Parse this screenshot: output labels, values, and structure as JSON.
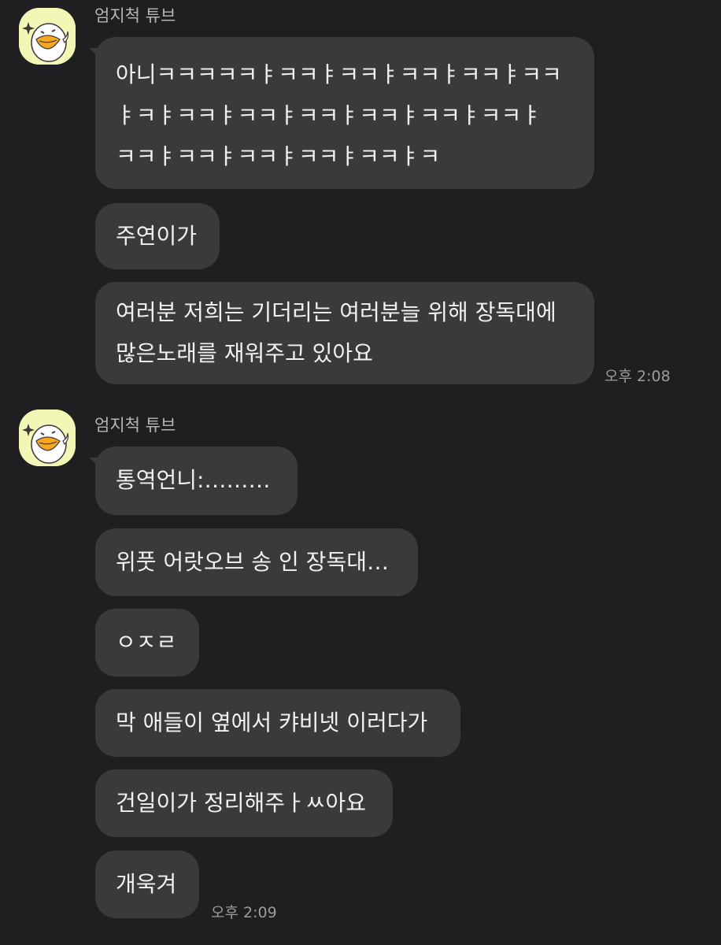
{
  "groups": [
    {
      "sender": "엄지척 튜브",
      "messages": [
        {
          "lines": [
            "아니ㅋㅋㅋㅋㅋㅑㅋㅋㅑㅋㅋㅑㅋㅋㅑㅋㅋㅑㅋㅋ",
            "ㅑㅋㅑㅋㅋㅑㅋㅋㅑㅋㅋㅑㅋㅋㅑㅋㅋㅑㅋㅋㅑ",
            "ㅋㅋㅑㅋㅋㅑㅋㅋㅑㅋㅋㅑㅋㅋㅑㅋ"
          ]
        },
        {
          "lines": [
            "주연이가"
          ]
        },
        {
          "lines": [
            "여러분 저희는 기더리는 여러분늘 위해 장독대에",
            "많은노래를 재워주고 있아요"
          ]
        }
      ],
      "time": "오후 2:08"
    },
    {
      "sender": "엄지척 튜브",
      "messages": [
        {
          "lines": [
            "통역언니:………"
          ]
        },
        {
          "lines": [
            "위풋 어랏오브 송 인 장독대…"
          ]
        },
        {
          "lines": [
            "ㅇㅈㄹ"
          ]
        },
        {
          "lines": [
            "막 애들이 옆에서 캬비넷 이러다가"
          ]
        },
        {
          "lines": [
            "건일이가 정리해주ㅏㅆ아요"
          ]
        },
        {
          "lines": [
            "개욱겨"
          ]
        }
      ],
      "time": "오후 2:09"
    }
  ]
}
